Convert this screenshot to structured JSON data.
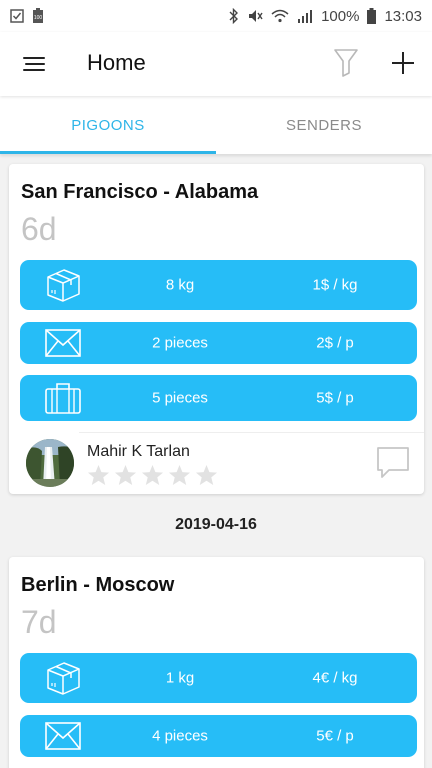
{
  "status_bar": {
    "battery": "100%",
    "time": "13:03",
    "badge": "100"
  },
  "header": {
    "title": "Home"
  },
  "tabs": [
    {
      "label": "PIGOONS",
      "active": true
    },
    {
      "label": "SENDERS",
      "active": false
    }
  ],
  "accent_color": "#2eb5e8",
  "pill_color": "#26bdf7",
  "listings": [
    {
      "route": "San Francisco - Alabama",
      "duration": "6d",
      "items": [
        {
          "icon": "package-icon",
          "quantity": "8 kg",
          "price": "1$ / kg"
        },
        {
          "icon": "envelope-icon",
          "quantity": "2 pieces",
          "price": "2$ / p"
        },
        {
          "icon": "suitcase-icon",
          "quantity": "5 pieces",
          "price": "5$ / p"
        }
      ],
      "sender": {
        "name": "Mahir K Tarlan",
        "rating": 0
      }
    },
    {
      "route": "Berlin - Moscow",
      "duration": "7d",
      "items": [
        {
          "icon": "package-icon",
          "quantity": "1 kg",
          "price": "4€ / kg"
        },
        {
          "icon": "envelope-icon",
          "quantity": "4 pieces",
          "price": "5€ / p"
        }
      ]
    }
  ],
  "date_separator": "2019-04-16"
}
